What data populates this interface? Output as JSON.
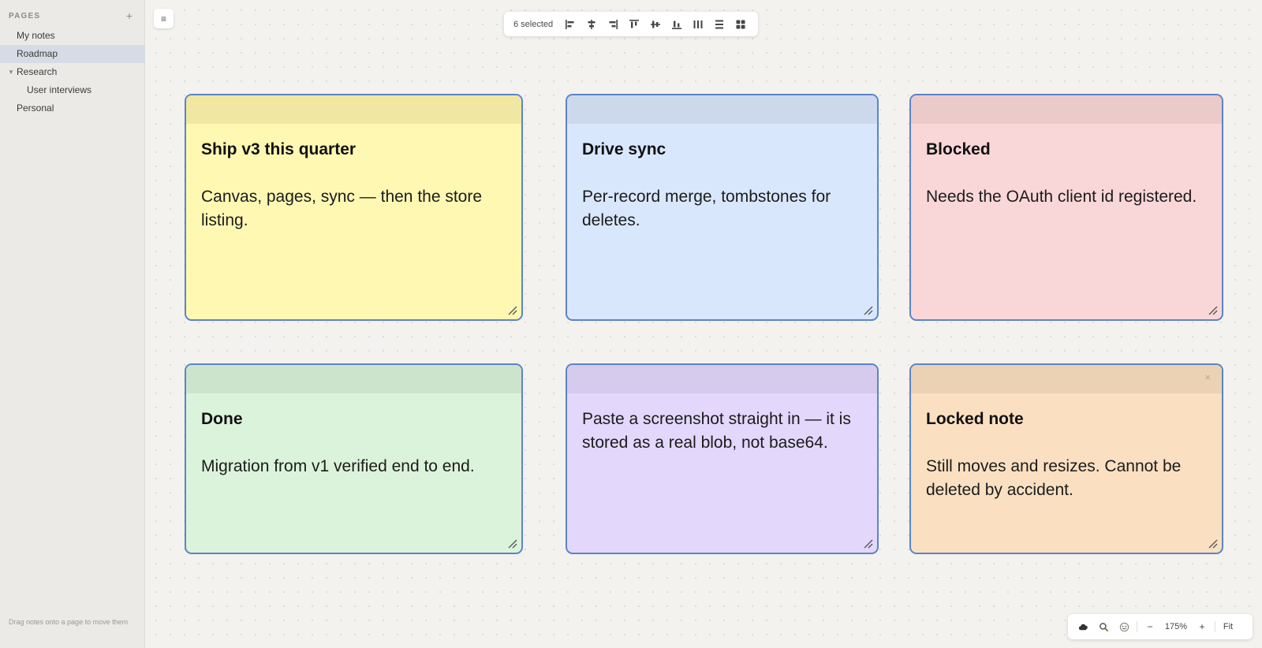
{
  "sidebar": {
    "title": "PAGES",
    "add_label": "+",
    "pages": [
      {
        "label": "My notes"
      },
      {
        "label": "Roadmap"
      },
      {
        "label": "Research"
      },
      {
        "label": "User interviews"
      },
      {
        "label": "Personal"
      }
    ],
    "active_page": "Roadmap",
    "footer": "Drag notes onto a page to move them"
  },
  "canvas": {
    "menu_icon": "hamburger-icon"
  },
  "toolbar": {
    "selected_label": "6 selected",
    "buttons": [
      {
        "icon": "align-left-icon"
      },
      {
        "icon": "align-center-horizontal-icon"
      },
      {
        "icon": "align-right-icon"
      },
      {
        "icon": "align-top-icon"
      },
      {
        "icon": "align-middle-vertical-icon"
      },
      {
        "icon": "align-bottom-icon"
      },
      {
        "icon": "distribute-horizontal-icon"
      },
      {
        "icon": "distribute-vertical-icon"
      },
      {
        "icon": "grid-arrange-icon"
      }
    ]
  },
  "notes": [
    {
      "title": "Ship v3 this quarter",
      "text": "Canvas, pages, sync — then the store listing.",
      "bg": "#fff8b3",
      "bar": "#f0e8a2",
      "selected": true
    },
    {
      "title": "Drive sync",
      "text": "Per-record merge, tombstones for deletes.",
      "bg": "#d9e7fd",
      "bar": "#ccd9ec",
      "selected": true
    },
    {
      "title": "Blocked",
      "text": "Needs the OAuth client id registered.",
      "bg": "#f9d7d8",
      "bar": "#ebcaca",
      "selected": true
    },
    {
      "title": "Done",
      "text": "Migration from v1 verified end to end.",
      "bg": "#dbf3da",
      "bar": "#cde4cc",
      "selected": true
    },
    {
      "title": "",
      "text": "Paste a screenshot straight in — it is stored as a real blob, not base64.",
      "bg": "#e3d7fb",
      "bar": "#d6caed",
      "selected": true
    },
    {
      "title": "Locked note",
      "text": "Still moves and resizes. Cannot be deleted by accident.",
      "bg": "#fae0c1",
      "bar": "#ebd2b4",
      "selected": true,
      "locked": true,
      "close_glyph": "×"
    }
  ],
  "zoombar": {
    "icons": [
      "cloud-icon",
      "search-icon",
      "smiley-icon"
    ],
    "zoom_out_label": "−",
    "zoom_level": "175%",
    "zoom_in_label": "+",
    "fit_label": "Fit"
  }
}
